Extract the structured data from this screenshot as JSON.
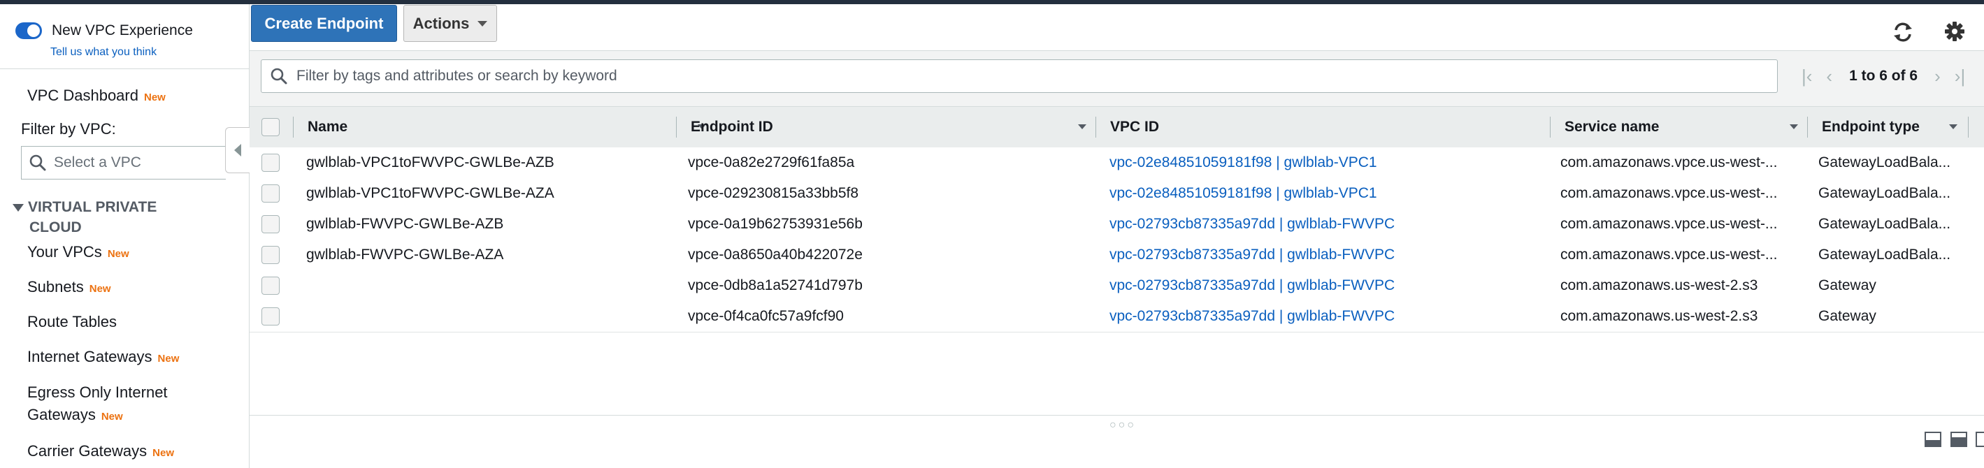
{
  "sidebar": {
    "toggle_label": "New VPC Experience",
    "tell_us": "Tell us what you think",
    "dashboard": "VPC Dashboard",
    "new_badge": "New",
    "filter_label": "Filter by VPC:",
    "vpc_select_placeholder": "Select a VPC",
    "section_title_line1": "VIRTUAL PRIVATE",
    "section_title_line2": "CLOUD",
    "items": [
      {
        "label": "Your VPCs",
        "badge": "New"
      },
      {
        "label": "Subnets",
        "badge": "New"
      },
      {
        "label": "Route Tables",
        "badge": ""
      },
      {
        "label": "Internet Gateways",
        "badge": "New"
      },
      {
        "label": "Egress Only Internet Gateways",
        "badge": "New"
      },
      {
        "label": "Carrier Gateways",
        "badge": "New"
      }
    ]
  },
  "toolbar": {
    "create_label": "Create Endpoint",
    "actions_label": "Actions"
  },
  "search": {
    "placeholder": "Filter by tags and attributes or search by keyword"
  },
  "pagination": {
    "text": "1 to 6 of 6"
  },
  "table": {
    "columns": [
      "Name",
      "Endpoint ID",
      "VPC ID",
      "Service name",
      "Endpoint type"
    ],
    "rows": [
      {
        "name": "gwlblab-VPC1toFWVPC-GWLBe-AZB",
        "endpoint_id": "vpce-0a82e2729f61fa85a",
        "vpc_id": "vpc-02e84851059181f98 | gwlblab-VPC1",
        "service": "com.amazonaws.vpce.us-west-...",
        "type": "GatewayLoadBala..."
      },
      {
        "name": "gwlblab-VPC1toFWVPC-GWLBe-AZA",
        "endpoint_id": "vpce-029230815a33bb5f8",
        "vpc_id": "vpc-02e84851059181f98 | gwlblab-VPC1",
        "service": "com.amazonaws.vpce.us-west-...",
        "type": "GatewayLoadBala..."
      },
      {
        "name": "gwlblab-FWVPC-GWLBe-AZB",
        "endpoint_id": "vpce-0a19b62753931e56b",
        "vpc_id": "vpc-02793cb87335a97dd | gwlblab-FWVPC",
        "service": "com.amazonaws.vpce.us-west-...",
        "type": "GatewayLoadBala..."
      },
      {
        "name": "gwlblab-FWVPC-GWLBe-AZA",
        "endpoint_id": "vpce-0a8650a40b422072e",
        "vpc_id": "vpc-02793cb87335a97dd | gwlblab-FWVPC",
        "service": "com.amazonaws.vpce.us-west-...",
        "type": "GatewayLoadBala..."
      },
      {
        "name": "",
        "endpoint_id": "vpce-0db8a1a52741d797b",
        "vpc_id": "vpc-02793cb87335a97dd | gwlblab-FWVPC",
        "service": "com.amazonaws.us-west-2.s3",
        "type": "Gateway"
      },
      {
        "name": "",
        "endpoint_id": "vpce-0f4ca0fc57a9fcf90",
        "vpc_id": "vpc-02793cb87335a97dd | gwlblab-FWVPC",
        "service": "com.amazonaws.us-west-2.s3",
        "type": "Gateway"
      }
    ]
  },
  "colors": {
    "primary": "#2e73b8",
    "link": "#0a5fbf",
    "new_badge": "#ec7211",
    "topbar": "#232f3e"
  }
}
